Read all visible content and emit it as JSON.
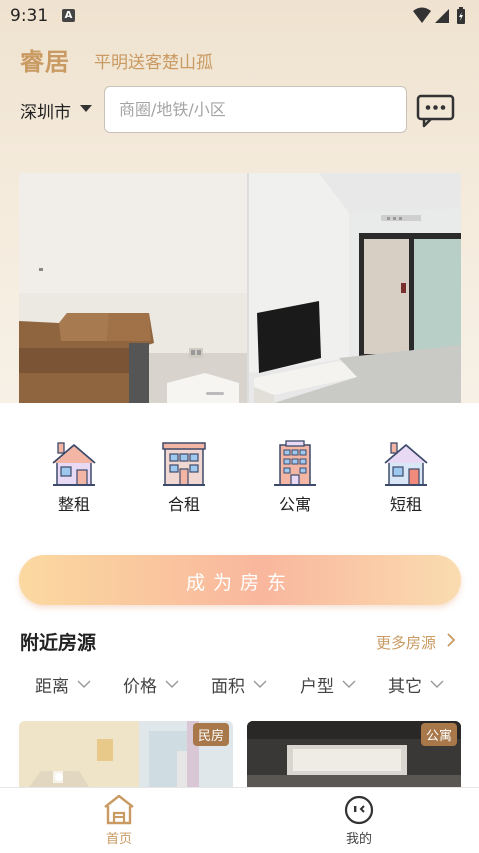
{
  "status_bar": {
    "time": "9:31",
    "notification_glyph": "A"
  },
  "brand": {
    "name": "睿居",
    "slogan": "平明送客楚山孤"
  },
  "search": {
    "city": "深圳市",
    "placeholder": "商圈/地铁/小区",
    "value": ""
  },
  "categories": [
    {
      "label": "整租",
      "icon": "house-icon"
    },
    {
      "label": "合租",
      "icon": "building-icon"
    },
    {
      "label": "公寓",
      "icon": "apartment-icon"
    },
    {
      "label": "短租",
      "icon": "cottage-icon"
    }
  ],
  "landlord_button": "成为房东",
  "nearby": {
    "title": "附近房源",
    "more": "更多房源",
    "filters": [
      "距离",
      "价格",
      "面积",
      "户型",
      "其它"
    ],
    "listings": [
      {
        "badge": "民房"
      },
      {
        "badge": "公寓"
      }
    ]
  },
  "bottom_nav": [
    {
      "label": "首页",
      "active": true
    },
    {
      "label": "我的",
      "active": false
    }
  ],
  "colors": {
    "accent": "#c99a62",
    "badge": "#a8774a",
    "landlord_gradient_start": "#fbd9a0",
    "landlord_gradient_end": "#f9b79d"
  }
}
